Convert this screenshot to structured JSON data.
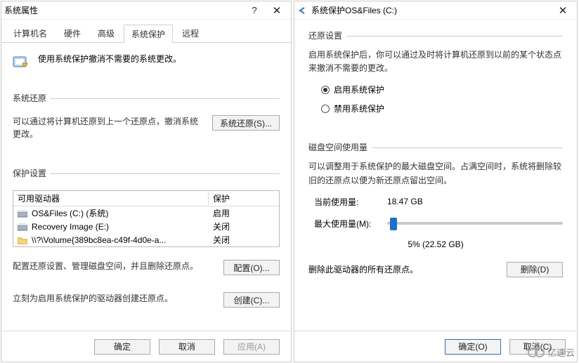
{
  "left": {
    "title": "系统属性",
    "tabs": [
      "计算机名",
      "硬件",
      "高级",
      "系统保护",
      "远程"
    ],
    "selected_tab": "系统保护",
    "intro": "使用系统保护撤消不需要的系统更改。",
    "section_restore": "系统还原",
    "restore_text": "可以通过将计算机还原到上一个还原点，撤消系统更改。",
    "btn_restore": "系统还原(S)...",
    "section_settings": "保护设置",
    "col_drive": "可用驱动器",
    "col_prot": "保护",
    "drives": [
      {
        "icon": "drive",
        "name": "OS&Files (C:) (系统)",
        "status": "启用"
      },
      {
        "icon": "drive",
        "name": "Recovery Image (E:)",
        "status": "关闭"
      },
      {
        "icon": "folder",
        "name": "\\\\?\\Volume{389bc8ea-c49f-4d0e-a...",
        "status": "关闭"
      }
    ],
    "config_text": "配置还原设置、管理磁盘空间，并且删除还原点。",
    "btn_config": "配置(O)...",
    "create_text": "立刻为启用系统保护的驱动器创建还原点。",
    "btn_create": "创建(C)...",
    "btn_ok": "确定",
    "btn_cancel": "取消",
    "btn_apply": "应用(A)"
  },
  "right": {
    "title": "系统保护OS&Files (C:)",
    "section_restore_settings": "还原设置",
    "restore_desc": "启用系统保护后，你可以通过及时将计算机还原到以前的某个状态点来撤消不需要的更改。",
    "radio_enable": "启用系统保护",
    "radio_disable": "禁用系统保护",
    "radio_selected": "enable",
    "section_disk": "磁盘空间使用量",
    "disk_desc": "可以调整用于系统保护的最大磁盘空间。占满空间时，系统将删除较旧的还原点以便为新还原点留出空间。",
    "current_label": "当前使用量:",
    "current_value": "18.47 GB",
    "max_label": "最大使用量(M):",
    "pct_text": "5% (22.52 GB)",
    "delete_text": "删除此驱动器的所有还原点。",
    "btn_delete": "删除(D)",
    "btn_ok": "确定(O)",
    "btn_cancel": "取消(C)"
  },
  "brand": "亿速云"
}
